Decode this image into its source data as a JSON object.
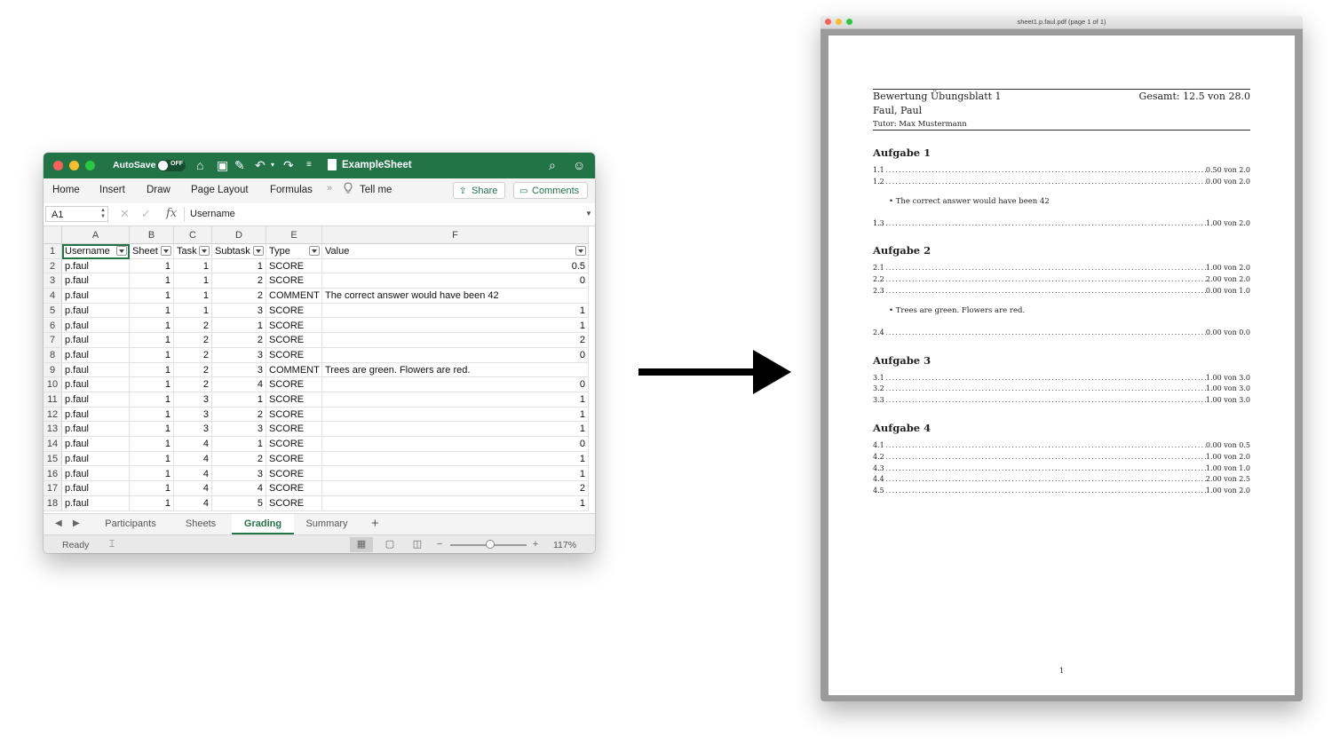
{
  "excel": {
    "autosave_label": "AutoSave",
    "autosave_state": "OFF",
    "doc_title": "ExampleSheet",
    "ribbon_tabs": [
      "Home",
      "Insert",
      "Draw",
      "Page Layout",
      "Formulas"
    ],
    "tell_me": "Tell me",
    "share": "Share",
    "comments": "Comments",
    "name_box": "A1",
    "formula_value": "Username",
    "columns": [
      "A",
      "B",
      "C",
      "D",
      "E",
      "F"
    ],
    "header_row": {
      "rownum": "1",
      "username": "Username",
      "sheet": "Sheet",
      "task": "Task",
      "subtask": "Subtask",
      "type": "Type",
      "value": "Value"
    },
    "rows": [
      {
        "rownum": "2",
        "username": "p.faul",
        "sheet": "1",
        "task": "1",
        "subtask": "1",
        "type": "SCORE",
        "value": "0.5"
      },
      {
        "rownum": "3",
        "username": "p.faul",
        "sheet": "1",
        "task": "1",
        "subtask": "2",
        "type": "SCORE",
        "value": "0"
      },
      {
        "rownum": "4",
        "username": "p.faul",
        "sheet": "1",
        "task": "1",
        "subtask": "2",
        "type": "COMMENT",
        "value": "The correct answer would have been 42"
      },
      {
        "rownum": "5",
        "username": "p.faul",
        "sheet": "1",
        "task": "1",
        "subtask": "3",
        "type": "SCORE",
        "value": "1"
      },
      {
        "rownum": "6",
        "username": "p.faul",
        "sheet": "1",
        "task": "2",
        "subtask": "1",
        "type": "SCORE",
        "value": "1"
      },
      {
        "rownum": "7",
        "username": "p.faul",
        "sheet": "1",
        "task": "2",
        "subtask": "2",
        "type": "SCORE",
        "value": "2"
      },
      {
        "rownum": "8",
        "username": "p.faul",
        "sheet": "1",
        "task": "2",
        "subtask": "3",
        "type": "SCORE",
        "value": "0"
      },
      {
        "rownum": "9",
        "username": "p.faul",
        "sheet": "1",
        "task": "2",
        "subtask": "3",
        "type": "COMMENT",
        "value": "Trees are green. Flowers are red."
      },
      {
        "rownum": "10",
        "username": "p.faul",
        "sheet": "1",
        "task": "2",
        "subtask": "4",
        "type": "SCORE",
        "value": "0"
      },
      {
        "rownum": "11",
        "username": "p.faul",
        "sheet": "1",
        "task": "3",
        "subtask": "1",
        "type": "SCORE",
        "value": "1"
      },
      {
        "rownum": "12",
        "username": "p.faul",
        "sheet": "1",
        "task": "3",
        "subtask": "2",
        "type": "SCORE",
        "value": "1"
      },
      {
        "rownum": "13",
        "username": "p.faul",
        "sheet": "1",
        "task": "3",
        "subtask": "3",
        "type": "SCORE",
        "value": "1"
      },
      {
        "rownum": "14",
        "username": "p.faul",
        "sheet": "1",
        "task": "4",
        "subtask": "1",
        "type": "SCORE",
        "value": "0"
      },
      {
        "rownum": "15",
        "username": "p.faul",
        "sheet": "1",
        "task": "4",
        "subtask": "2",
        "type": "SCORE",
        "value": "1"
      },
      {
        "rownum": "16",
        "username": "p.faul",
        "sheet": "1",
        "task": "4",
        "subtask": "3",
        "type": "SCORE",
        "value": "1"
      },
      {
        "rownum": "17",
        "username": "p.faul",
        "sheet": "1",
        "task": "4",
        "subtask": "4",
        "type": "SCORE",
        "value": "2"
      },
      {
        "rownum": "18",
        "username": "p.faul",
        "sheet": "1",
        "task": "4",
        "subtask": "5",
        "type": "SCORE",
        "value": "1"
      }
    ],
    "sheet_tabs": [
      "Participants",
      "Sheets",
      "Grading",
      "Summary"
    ],
    "active_tab": "Grading",
    "status": "Ready",
    "zoom": "117%",
    "accent_color": "#227447"
  },
  "pdf": {
    "window_title": "sheet1.p.faul.pdf (page 1 of 1)",
    "heading": "Bewertung Übungsblatt 1",
    "total": "Gesamt: 12.5 von 28.0",
    "student": "Faul, Paul",
    "tutor": "Tutor: Max Mustermann",
    "sections": [
      {
        "title": "Aufgabe 1",
        "items": [
          {
            "label": "1.1",
            "score": "0.50 von 2.0"
          },
          {
            "label": "1.2",
            "score": "0.00 von 2.0",
            "comment": "The correct answer would have been 42"
          },
          {
            "label": "1.3",
            "score": "1.00 von 2.0"
          }
        ]
      },
      {
        "title": "Aufgabe 2",
        "items": [
          {
            "label": "2.1",
            "score": "1.00 von 2.0"
          },
          {
            "label": "2.2",
            "score": "2.00 von 2.0"
          },
          {
            "label": "2.3",
            "score": "0.00 von 1.0",
            "comment": "Trees are green. Flowers are red."
          },
          {
            "label": "2.4",
            "score": "0.00 von 0.0"
          }
        ]
      },
      {
        "title": "Aufgabe 3",
        "items": [
          {
            "label": "3.1",
            "score": "1.00 von 3.0"
          },
          {
            "label": "3.2",
            "score": "1.00 von 3.0"
          },
          {
            "label": "3.3",
            "score": "1.00 von 3.0"
          }
        ]
      },
      {
        "title": "Aufgabe 4",
        "items": [
          {
            "label": "4.1",
            "score": "0.00 von 0.5"
          },
          {
            "label": "4.2",
            "score": "1.00 von 2.0"
          },
          {
            "label": "4.3",
            "score": "1.00 von 1.0"
          },
          {
            "label": "4.4",
            "score": "2.00 von 2.5"
          },
          {
            "label": "4.5",
            "score": "1.00 von 2.0"
          }
        ]
      }
    ],
    "page_number": "1"
  }
}
